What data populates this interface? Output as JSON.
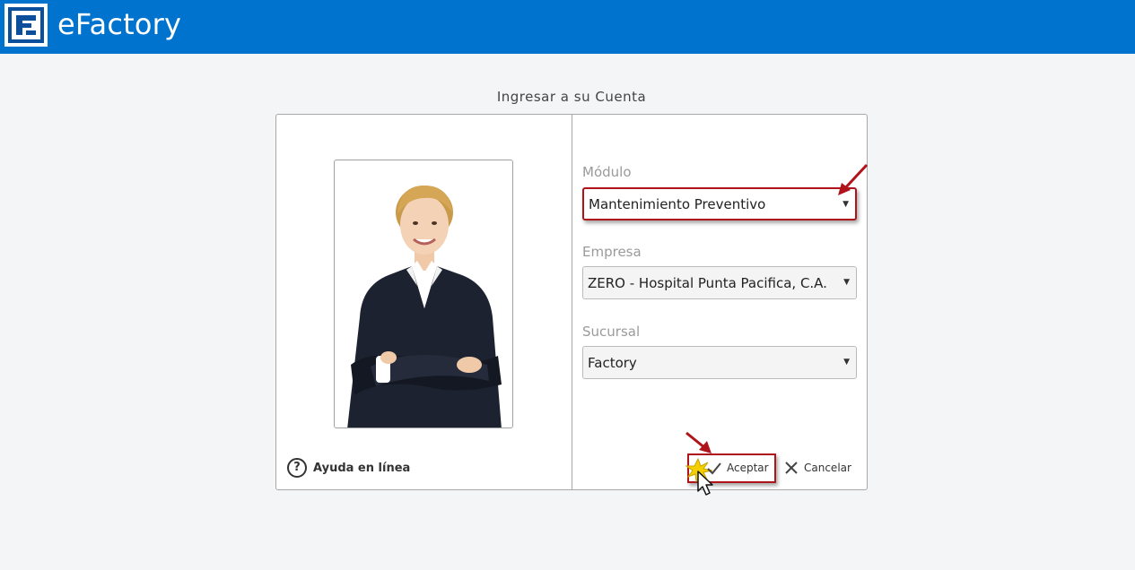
{
  "header": {
    "logo_icon": "efactory-logo-icon",
    "app_name": "eFactory",
    "bar_color": "#0073cf"
  },
  "login": {
    "title": "Ingresar a su Cuenta",
    "help_label": "Ayuda en línea",
    "modulo": {
      "label": "Módulo",
      "value": "Mantenimiento Preventivo"
    },
    "empresa": {
      "label": "Empresa",
      "value": "ZERO - Hospital Punta Pacifica, C.A."
    },
    "sucursal": {
      "label": "Sucursal",
      "value": "Factory"
    },
    "accept_label": "Aceptar",
    "cancel_label": "Cancelar",
    "highlight_color": "#b0141b"
  }
}
